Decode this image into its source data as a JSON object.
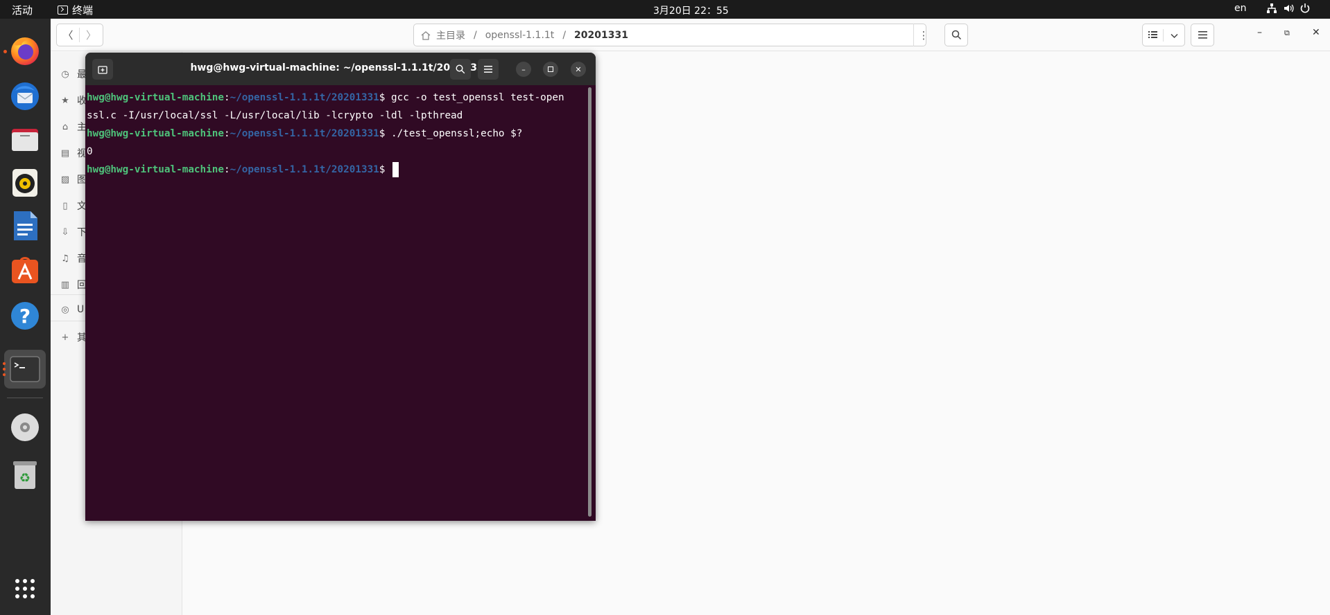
{
  "topbar": {
    "activities": "活动",
    "app_name": "终端",
    "clock": "3月20日  22：55",
    "lang": "en",
    "tray_icons": [
      "network-icon",
      "volume-icon",
      "power-icon"
    ]
  },
  "dock": {
    "apps": [
      "firefox",
      "thunderbird",
      "files",
      "rhythmbox",
      "libreoffice-writer",
      "ubuntu-software",
      "help",
      "terminal",
      "dvd-drive",
      "trash",
      "show-applications"
    ]
  },
  "files": {
    "path": {
      "home": "主目录",
      "sep": "/",
      "folder": "openssl-1.1.1t",
      "current": "20201331"
    },
    "sidebar": {
      "items": [
        {
          "icon": "clock-icon",
          "label": "最"
        },
        {
          "icon": "star-icon",
          "label": "收"
        },
        {
          "icon": "home-icon",
          "label": "主"
        },
        {
          "icon": "film-icon",
          "label": "视"
        },
        {
          "icon": "image-icon",
          "label": "图"
        },
        {
          "icon": "document-icon",
          "label": "文"
        },
        {
          "icon": "download-icon",
          "label": "下"
        },
        {
          "icon": "music-icon",
          "label": "音"
        },
        {
          "icon": "trash-icon",
          "label": "回"
        }
      ],
      "drive": {
        "icon": "disc-icon",
        "label": "U"
      },
      "other": {
        "icon": "plus-icon",
        "label": "其"
      }
    }
  },
  "terminal": {
    "title": "hwg@hwg-virtual-machine: ~/openssl-1.1.1t/20201331",
    "lines": {
      "l1_user": "hwg@hwg-virtual-machine",
      "l1_colon": ":",
      "l1_path": "~/openssl-1.1.1t/20201331",
      "l1_cmd": "$ gcc -o test_openssl test-open",
      "l2_text": "ssl.c -I/usr/local/ssl -L/usr/local/lib -lcrypto -ldl -lpthread",
      "l3_user": "hwg@hwg-virtual-machine",
      "l3_colon": ":",
      "l3_path": "~/openssl-1.1.1t/20201331",
      "l3_cmd": "$ ./test_openssl;echo $?",
      "l4_text": "0",
      "l5_user": "hwg@hwg-virtual-machine",
      "l5_colon": ":",
      "l5_path": "~/openssl-1.1.1t/20201331",
      "l5_cmd": "$ "
    }
  }
}
